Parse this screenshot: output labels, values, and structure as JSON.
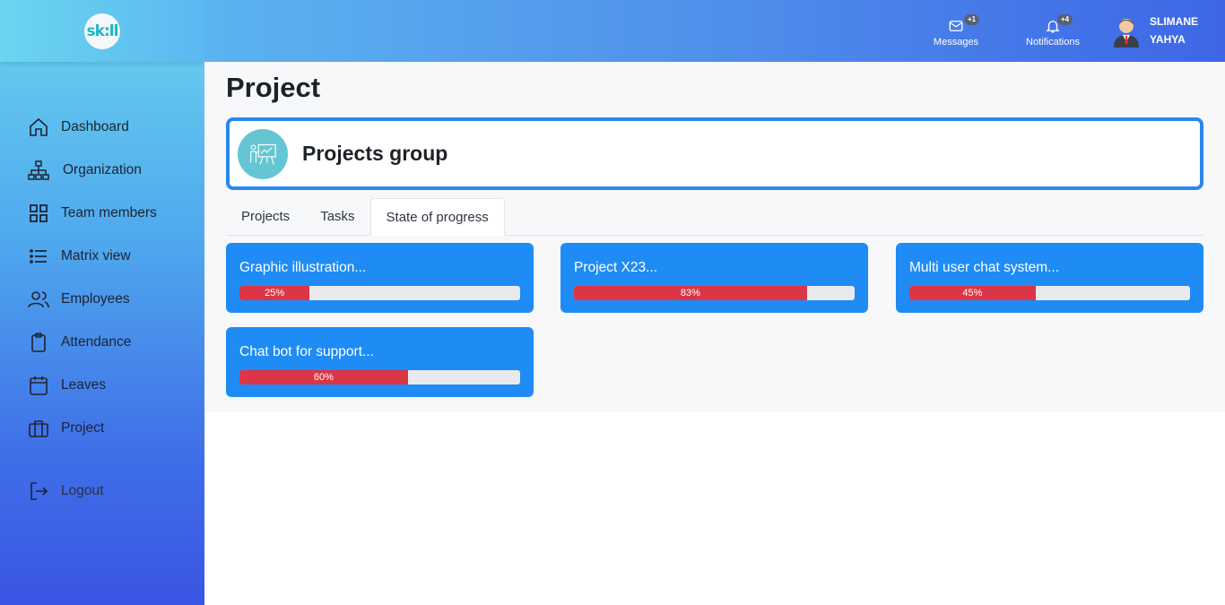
{
  "app": {
    "logo_text": "sk:ll"
  },
  "sidebar": {
    "items": [
      {
        "label": "Dashboard",
        "icon": "home-icon"
      },
      {
        "label": "Organization",
        "icon": "org-chart-icon"
      },
      {
        "label": "Team members",
        "icon": "grid-icon"
      },
      {
        "label": "Matrix view",
        "icon": "list-icon"
      },
      {
        "label": "Employees",
        "icon": "people-icon"
      },
      {
        "label": "Attendance",
        "icon": "clipboard-icon"
      },
      {
        "label": "Leaves",
        "icon": "calendar-icon"
      },
      {
        "label": "Project",
        "icon": "briefcase-icon"
      }
    ],
    "logout": {
      "label": "Logout",
      "icon": "logout-icon"
    }
  },
  "header": {
    "messages": {
      "label": "Messages",
      "badge": "+1"
    },
    "notifications": {
      "label": "Notifications",
      "badge": "+4"
    },
    "user": {
      "first_name": "SLIMANE",
      "last_name": "YAHYA"
    }
  },
  "main": {
    "page_title": "Project",
    "group_title": "Projects group",
    "tabs": [
      {
        "label": "Projects",
        "active": false
      },
      {
        "label": "Tasks",
        "active": false
      },
      {
        "label": "State of progress",
        "active": true
      }
    ],
    "projects": [
      {
        "title": "Graphic illustration...",
        "progress": 25,
        "progress_label": "25%"
      },
      {
        "title": "Project X23...",
        "progress": 83,
        "progress_label": "83%"
      },
      {
        "title": "Multi user chat system...",
        "progress": 45,
        "progress_label": "45%"
      },
      {
        "title": "Chat bot for support...",
        "progress": 60,
        "progress_label": "60%"
      }
    ]
  },
  "colors": {
    "accent": "#1f8bf5",
    "progress": "#dc3545",
    "card_border": "#2a87ec"
  }
}
